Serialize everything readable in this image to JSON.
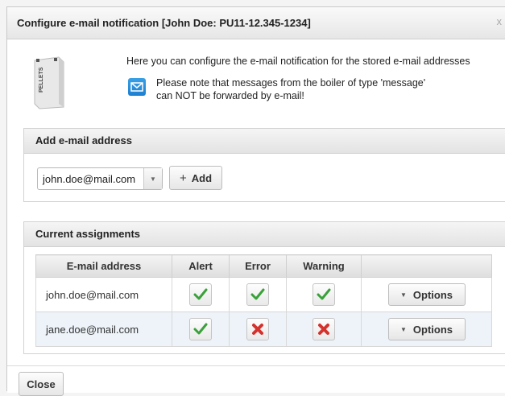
{
  "dialog": {
    "title": "Configure e-mail notification [John Doe: PU11-12.345-1234]",
    "close_glyph": "x"
  },
  "intro": {
    "boiler_label": "PELLETS",
    "line1": "Here you can configure the e-mail notification for the stored e-mail addresses",
    "note_line1": "Please note that messages from the boiler of type 'message'",
    "note_line2": "can NOT be forwarded by e-mail!",
    "note_icon": "envelope-icon"
  },
  "add_section": {
    "title": "Add e-mail address",
    "selected_email": "john.doe@mail.com",
    "add_label": "Add",
    "add_icon": "+"
  },
  "assign_section": {
    "title": "Current assignments",
    "columns": [
      "E-mail address",
      "Alert",
      "Error",
      "Warning",
      ""
    ],
    "rows": [
      {
        "email": "john.doe@mail.com",
        "alert": true,
        "error": true,
        "warning": true,
        "options_label": "Options"
      },
      {
        "email": "jane.doe@mail.com",
        "alert": true,
        "error": false,
        "warning": false,
        "options_label": "Options"
      }
    ]
  },
  "footer": {
    "close_label": "Close"
  },
  "colors": {
    "check_green": "#3aa13a",
    "cross_red": "#d4322c",
    "accent_blue": "#1d7fd0"
  }
}
